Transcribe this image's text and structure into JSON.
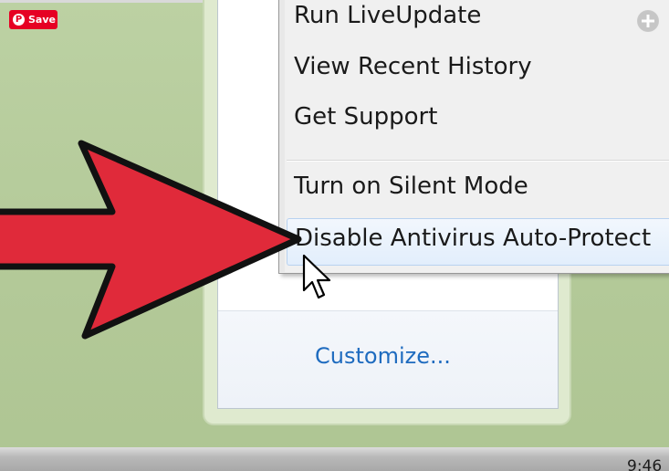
{
  "context_menu": {
    "items": [
      {
        "label": "Run LiveUpdate"
      },
      {
        "label": "View Recent History"
      },
      {
        "label": "Get Support"
      },
      {
        "label": "Turn on Silent Mode"
      },
      {
        "label": "Disable Antivirus Auto-Protect"
      }
    ]
  },
  "tray_panel": {
    "customize_label": "Customize..."
  },
  "overlay": {
    "save_label": "Save"
  },
  "taskbar": {
    "clock_text": "9:46"
  },
  "icons": {
    "pin": "pinterest-logo-icon",
    "expand": "expand-plus-icon",
    "arrow": "red-pointer-arrow-icon",
    "cursor": "mouse-cursor-icon"
  },
  "colors": {
    "arrow_fill": "#e02a3a",
    "link": "#1e6bbf",
    "menu_bg": "#f0f0f0",
    "desktop": "#b6cc9c",
    "pin_red": "#e60023"
  }
}
